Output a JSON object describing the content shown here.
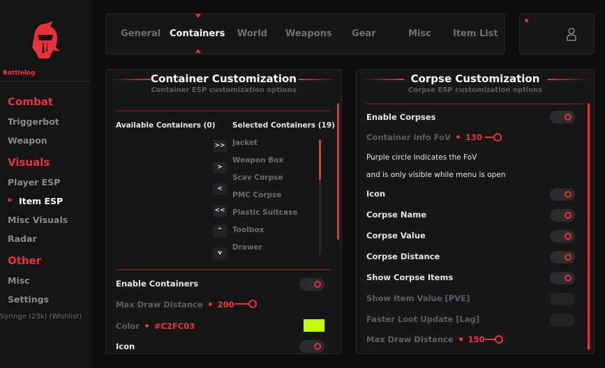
{
  "sidebar": {
    "brand": "Battlelog",
    "categories": [
      {
        "label": "Combat",
        "items": [
          "Triggerbot",
          "Weapon"
        ]
      },
      {
        "label": "Visuals",
        "items": [
          "Player ESP",
          "Item ESP",
          "Misc Visuals",
          "Radar"
        ]
      },
      {
        "label": "Other",
        "items": [
          "Misc",
          "Settings"
        ]
      }
    ],
    "active_item": "Item ESP",
    "overlay_text": "Syringe (23k) (Wishlist)"
  },
  "tabs": [
    "General",
    "Containers",
    "World",
    "Weapons",
    "Gear",
    "Misc",
    "Item List"
  ],
  "active_tab": "Containers",
  "colors": {
    "accent": "#e8333b",
    "swatch": "#C2FC03"
  },
  "container_panel": {
    "title": "Container Customization",
    "subtitle": "Container ESP customization options",
    "available_header": "Available Containers (0)",
    "selected_header": "Selected Containers (19)",
    "selected_items": [
      "Jacket",
      "Weapon Box",
      "Scav Corpse",
      "PMC Corpse",
      "Plastic Suitcase",
      "Toolbox",
      "Drawer"
    ],
    "move_buttons": [
      ">>",
      ">",
      "<",
      "<<",
      "^",
      "v"
    ],
    "enable_label": "Enable Containers",
    "enable_on": true,
    "max_draw_label": "Max Draw Distance",
    "max_draw_value": "200",
    "color_label": "Color",
    "color_value": "#C2FC03",
    "icon_label": "Icon",
    "icon_on": true
  },
  "corpse_panel": {
    "title": "Corpse Customization",
    "subtitle": "Corpse ESP customization options",
    "enable_label": "Enable Corpses",
    "fov_label": "Container Info FoV",
    "fov_value": "130",
    "info_line1": "Purple circle indicates the FoV",
    "info_line2": "and is only visible while menu is open",
    "toggles": [
      {
        "label": "Icon",
        "on": true
      },
      {
        "label": "Corpse Name",
        "on": true
      },
      {
        "label": "Corpse Value",
        "on": true
      },
      {
        "label": "Corpse Distance",
        "on": true
      },
      {
        "label": "Show Corpse Items",
        "on": true
      },
      {
        "label": "Show Item Value [PVE]",
        "on": false
      },
      {
        "label": "Faster Loot Update [Lag]",
        "on": false
      }
    ],
    "max_draw_label": "Max Draw Distance",
    "max_draw_value": "150"
  }
}
